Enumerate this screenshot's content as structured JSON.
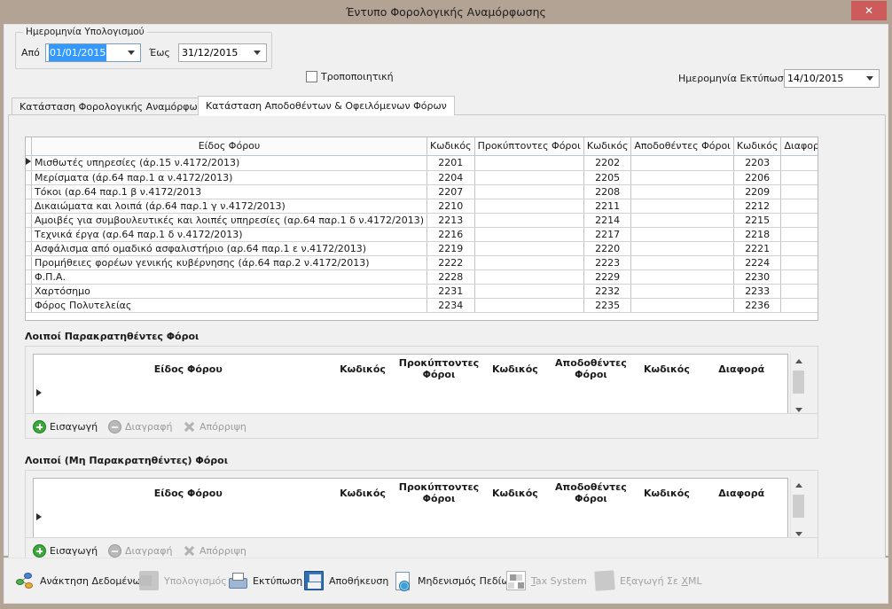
{
  "window": {
    "title": "Έντυπο Φορολογικής Αναμόρφωσης",
    "close_label": "✕",
    "accent_titlebar": "#b3a394",
    "accent_close": "#cd5b5b"
  },
  "calc_date_group": {
    "legend": "Ημερομηνία Υπολογισμού",
    "from_label": "Από",
    "from_value": "01/01/2015",
    "to_label": "Έως",
    "to_value": "31/12/2015"
  },
  "amending": {
    "label": "Τροποποιητική",
    "checked": false
  },
  "print_date": {
    "label": "Ημερομηνία Εκτύπωσης",
    "value": "14/10/2015"
  },
  "tabs": [
    {
      "label": "Κατάσταση Φορολογικής Αναμόρφωσης",
      "active": false
    },
    {
      "label": "Κατάσταση Αποδοθέντων & Οφειλόμενων Φόρων",
      "active": true
    }
  ],
  "main_grid": {
    "headers": {
      "row_marker": "",
      "kind": "Είδος Φόρου",
      "code1": "Κωδικός",
      "accrued": "Προκύπτοντες Φόροι",
      "code2": "Κωδικός",
      "rendered": "Αποδοθέντες Φόροι",
      "code3": "Κωδικός",
      "difference": "Διαφορά"
    },
    "rows": [
      {
        "marker": "▶",
        "kind": "Μισθωτές υπηρεσίες  (άρ.15 ν.4172/2013)",
        "code1": "2201",
        "accrued": "",
        "code2": "2202",
        "rendered": "",
        "code3": "2203",
        "difference": ""
      },
      {
        "marker": "",
        "kind": "Μερίσματα (άρ.64 παρ.1 α ν.4172/2013)",
        "code1": "2204",
        "accrued": "",
        "code2": "2205",
        "rendered": "",
        "code3": "2206",
        "difference": ""
      },
      {
        "marker": "",
        "kind": "Τόκοι (αρ.64 παρ.1 β ν.4172/2013",
        "code1": "2207",
        "accrued": "",
        "code2": "2208",
        "rendered": "",
        "code3": "2209",
        "difference": ""
      },
      {
        "marker": "",
        "kind": "Δικαιώματα και λοιπά (άρ.64 παρ.1 γ ν.4172/2013)",
        "code1": "2210",
        "accrued": "",
        "code2": "2211",
        "rendered": "",
        "code3": "2212",
        "difference": ""
      },
      {
        "marker": "",
        "kind": "Αμοιβές για συμβουλευτικές και λοιπές υπηρεσίες (αρ.64 παρ.1 δ ν.4172/2013)",
        "code1": "2213",
        "accrued": "",
        "code2": "2214",
        "rendered": "",
        "code3": "2215",
        "difference": ""
      },
      {
        "marker": "",
        "kind": "Τεχνικά έργα (αρ.64 παρ.1 δ ν.4172/2013)",
        "code1": "2216",
        "accrued": "",
        "code2": "2217",
        "rendered": "",
        "code3": "2218",
        "difference": ""
      },
      {
        "marker": "",
        "kind": "Ασφάλισμα από ομαδικό ασφαλιστήριο (αρ.64 παρ.1 ε ν.4172/2013)",
        "code1": "2219",
        "accrued": "",
        "code2": "2220",
        "rendered": "",
        "code3": "2221",
        "difference": ""
      },
      {
        "marker": "",
        "kind": "Προμήθειες φορέων γενικής κυβέρνησης (άρ.64 παρ.2 ν.4172/2013)",
        "code1": "2222",
        "accrued": "",
        "code2": "2223",
        "rendered": "",
        "code3": "2224",
        "difference": ""
      },
      {
        "marker": "",
        "kind": "Φ.Π.Α.",
        "code1": "2228",
        "accrued": "",
        "code2": "2229",
        "rendered": "",
        "code3": "2230",
        "difference": ""
      },
      {
        "marker": "",
        "kind": "Χαρτόσημο",
        "code1": "2231",
        "accrued": "",
        "code2": "2232",
        "rendered": "",
        "code3": "2233",
        "difference": ""
      },
      {
        "marker": "",
        "kind": "Φόρος Πολυτελείας",
        "code1": "2234",
        "accrued": "",
        "code2": "2235",
        "rendered": "",
        "code3": "2236",
        "difference": ""
      }
    ]
  },
  "section_withheld": {
    "title": "Λοιποί Παρακρατηθέντες Φόροι",
    "headers": {
      "kind": "Είδος Φόρου",
      "code1": "Κωδικός",
      "accrued": "Προκύπτοντες Φόροι",
      "code2": "Κωδικός",
      "rendered": "Αποδοθέντες Φόροι",
      "code3": "Κωδικός",
      "difference": "Διαφορά"
    },
    "rows": [
      {
        "marker": "▶",
        "kind": "",
        "code1": "",
        "accrued": "",
        "code2": "",
        "rendered": "",
        "code3": "",
        "difference": ""
      }
    ],
    "actions": [
      {
        "label": "Εισαγωγή",
        "icon": "plus-circle-icon",
        "enabled": true
      },
      {
        "label": "Διαγραφή",
        "icon": "minus-circle-icon",
        "enabled": false
      },
      {
        "label": "Απόρριψη",
        "icon": "x-mark-icon",
        "enabled": false
      }
    ]
  },
  "section_not_withheld": {
    "title": "Λοιποί (Μη Παρακρατηθέντες) Φόροι",
    "headers": {
      "kind": "Είδος Φόρου",
      "code1": "Κωδικός",
      "accrued": "Προκύπτοντες Φόροι",
      "code2": "Κωδικός",
      "rendered": "Αποδοθέντες Φόροι",
      "code3": "Κωδικός",
      "difference": "Διαφορά"
    },
    "rows": [
      {
        "marker": "▶",
        "kind": "",
        "code1": "",
        "accrued": "",
        "code2": "",
        "rendered": "",
        "code3": "",
        "difference": ""
      }
    ],
    "actions": [
      {
        "label": "Εισαγωγή",
        "icon": "plus-circle-icon",
        "enabled": true
      },
      {
        "label": "Διαγραφή",
        "icon": "minus-circle-icon",
        "enabled": false
      },
      {
        "label": "Απόρριψη",
        "icon": "x-mark-icon",
        "enabled": false
      }
    ]
  },
  "toolbar": {
    "buttons": [
      {
        "label": "Ανάκτηση Δεδομένων",
        "icon": "retrieve-data-icon",
        "enabled": true
      },
      {
        "label": "Υπολογισμός",
        "icon": "calculator-icon",
        "enabled": false
      },
      {
        "label": "Εκτύπωση",
        "icon": "printer-icon",
        "enabled": true
      },
      {
        "label": "Αποθήκευση",
        "icon": "floppy-disk-icon",
        "enabled": true
      },
      {
        "label": "Μηδενισμός Πεδίων",
        "icon": "clear-fields-icon",
        "enabled": true
      },
      {
        "label": "Tax System",
        "icon": "tax-system-icon",
        "enabled": false
      },
      {
        "label": "Εξαγωγή Σε XML",
        "icon": "export-xml-icon",
        "enabled": false
      }
    ]
  }
}
